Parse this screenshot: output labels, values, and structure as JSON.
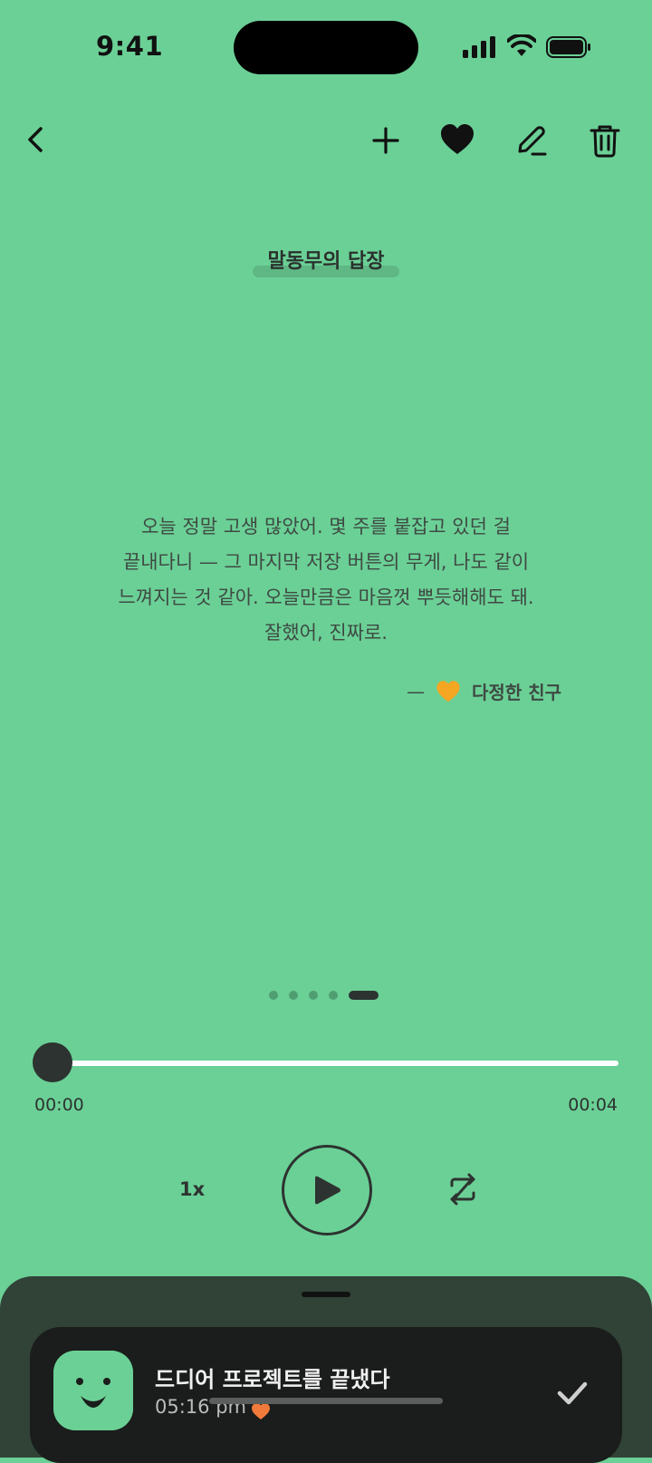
{
  "status_bar": {
    "time": "9:41"
  },
  "toolbar": {
    "back_icon": "chevron-left-icon",
    "add_icon": "plus-icon",
    "favorite_icon": "heart-icon",
    "edit_icon": "pencil-icon",
    "delete_icon": "trash-icon"
  },
  "page": {
    "title": "말동무의 답장",
    "message_lines": [
      "오늘 정말 고생 많았어. 몇 주를 붙잡고 있던 걸",
      "끝내다니 — 그 마지막 저장 버튼의 무게, 나도 같이",
      "느껴지는 것 같아. 오늘만큼은 마음껏 뿌듯해해도 돼.",
      "잘했어, 진짜로."
    ],
    "signature_dash": "—",
    "signature_name": "다정한 친구"
  },
  "pager": {
    "count": 5,
    "active_index": 4
  },
  "player": {
    "progress": 0.0,
    "current_time": "00:00",
    "total_time": "00:04",
    "speed": "1x"
  },
  "sheet": {
    "entry_title": "드디어 프로젝트를 끝냈다",
    "entry_time": "05:16 pm"
  },
  "colors": {
    "background": "#6bd096",
    "dark": "#2d3330",
    "sheet": "#314237",
    "card": "#1a1d1b",
    "heart_emoji": "#f5a623",
    "tag_dot": "#f07a3a"
  }
}
